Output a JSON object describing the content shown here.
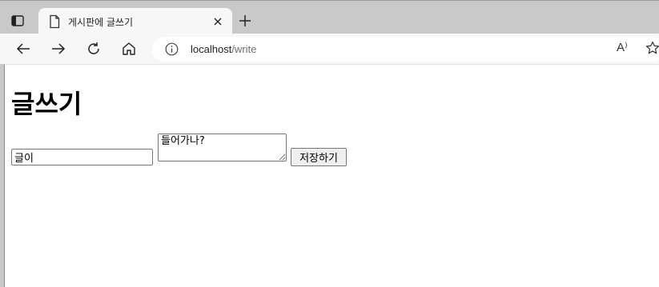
{
  "browser": {
    "tab": {
      "title": "게시판에 글쓰기",
      "close_glyph": "×"
    },
    "new_tab_glyph": "+",
    "address": {
      "host": "localhost",
      "path": "/write"
    },
    "read_aloud_label": "A⁾",
    "colors": {
      "frame": "#c9c9c9",
      "toolbar": "#f7f7f7",
      "page": "#ffffff"
    }
  },
  "page": {
    "heading": "글쓰기",
    "form": {
      "title_value": "글이",
      "body_value": "들어가나?",
      "submit_label": "저장하기"
    }
  }
}
